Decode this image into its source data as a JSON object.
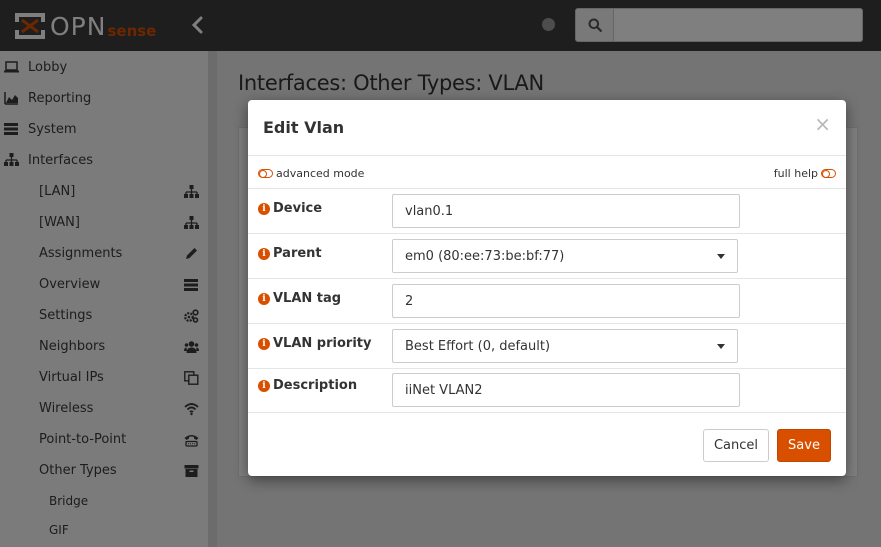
{
  "brand": {
    "logo_text": "OPN",
    "logo_sense": "sense",
    "accent_color": "#d94f00"
  },
  "header": {
    "search_placeholder": "",
    "search_value": ""
  },
  "sidebar": {
    "items": [
      {
        "label": "Lobby",
        "icon": "laptop-icon"
      },
      {
        "label": "Reporting",
        "icon": "area-chart-icon"
      },
      {
        "label": "System",
        "icon": "server-icon"
      },
      {
        "label": "Interfaces",
        "icon": "sitemap-icon"
      }
    ],
    "interfaces_sub": [
      {
        "label": "[LAN]",
        "icon": "sitemap-icon"
      },
      {
        "label": "[WAN]",
        "icon": "sitemap-icon"
      },
      {
        "label": "Assignments",
        "icon": "pencil-icon"
      },
      {
        "label": "Overview",
        "icon": "list-icon"
      },
      {
        "label": "Settings",
        "icon": "cogs-icon"
      },
      {
        "label": "Neighbors",
        "icon": "users-icon"
      },
      {
        "label": "Virtual IPs",
        "icon": "clone-icon"
      },
      {
        "label": "Wireless",
        "icon": "wifi-icon"
      },
      {
        "label": "Point-to-Point",
        "icon": "phone-icon"
      },
      {
        "label": "Other Types",
        "icon": "archive-icon"
      }
    ],
    "other_types_sub": [
      {
        "label": "Bridge"
      },
      {
        "label": "GIF"
      }
    ]
  },
  "main": {
    "page_title": "Interfaces: Other Types: VLAN"
  },
  "modal": {
    "title": "Edit Vlan",
    "close_glyph": "×",
    "advanced_mode_label": "advanced mode",
    "full_help_label": "full help",
    "fields": [
      {
        "label": "Device",
        "value": "vlan0.1",
        "type": "text"
      },
      {
        "label": "Parent",
        "value": "em0 (80:ee:73:be:bf:77)",
        "type": "select"
      },
      {
        "label": "VLAN tag",
        "value": "2",
        "type": "text"
      },
      {
        "label": "VLAN priority",
        "value": "Best Effort (0, default)",
        "type": "select"
      },
      {
        "label": "Description",
        "value": "iiNet VLAN2",
        "type": "text"
      }
    ],
    "cancel_label": "Cancel",
    "save_label": "Save"
  }
}
